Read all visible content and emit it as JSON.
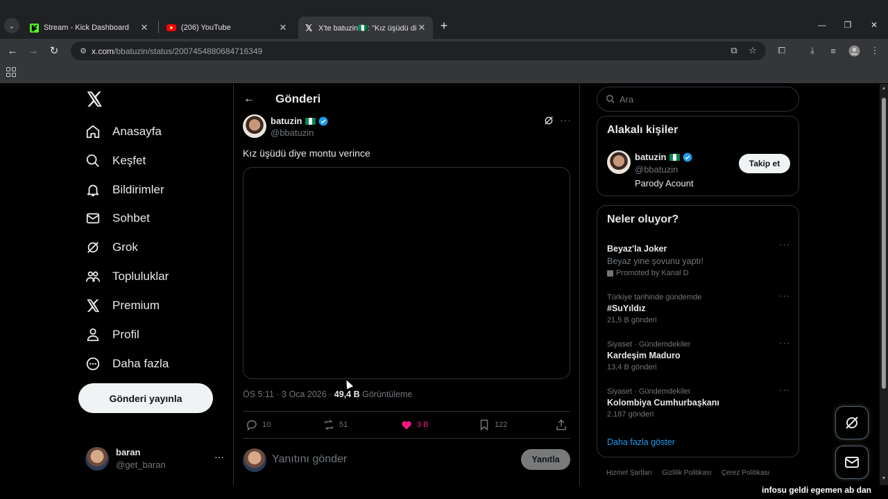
{
  "browser": {
    "tabs": [
      {
        "title": "Stream - Kick Dashboard",
        "close": "✕"
      },
      {
        "title": "(206) YouTube",
        "close": "✕"
      },
      {
        "title": "X'te batuzin🇳🇬: \"Kız üşüdü diye",
        "close": "✕"
      }
    ],
    "new_tab": "+",
    "url_host": "x.com",
    "url_path": "/bbatuzin/status/2007454880684716349",
    "window": {
      "minimize": "—",
      "restore": "❐",
      "close": "✕"
    }
  },
  "nav": {
    "items": [
      {
        "label": "Anasayfa",
        "icon": "home-icon"
      },
      {
        "label": "Keşfet",
        "icon": "search-icon"
      },
      {
        "label": "Bildirimler",
        "icon": "bell-icon"
      },
      {
        "label": "Sohbet",
        "icon": "mail-icon"
      },
      {
        "label": "Grok",
        "icon": "grok-icon"
      },
      {
        "label": "Topluluklar",
        "icon": "communities-icon"
      },
      {
        "label": "Premium",
        "icon": "x-icon"
      },
      {
        "label": "Profil",
        "icon": "person-icon"
      },
      {
        "label": "Daha fazla",
        "icon": "more-circle-icon"
      }
    ],
    "post_button": "Gönderi yayınla",
    "account": {
      "name": "baran",
      "handle": "@get_baran",
      "more": "···"
    }
  },
  "post": {
    "header_title": "Gönderi",
    "author_name": "batuzin",
    "author_handle": "@bbatuzin",
    "text": "Kız üşüdü diye montu verince",
    "time": "ÖS 5:11",
    "date": "3 Oca 2026",
    "views": "49,4 B",
    "views_label": "Görüntüleme",
    "replies": "10",
    "reposts": "51",
    "likes": "3 B",
    "bookmarks": "122",
    "reply_placeholder": "Yanıtını gönder",
    "reply_button": "Yanıtla"
  },
  "sidebar": {
    "search_placeholder": "Ara",
    "related_title": "Alakalı kişiler",
    "related": {
      "name": "batuzin",
      "handle": "@bbatuzin",
      "bio": "Parody Acount",
      "follow": "Takip et"
    },
    "trending_title": "Neler oluyor?",
    "trends": [
      {
        "name": "Beyaz'la Joker",
        "sub": "Beyaz yine şovunu yaptı!",
        "promo": "Promoted by Kanal D"
      },
      {
        "context": "Türkiye tarihinde gündemde",
        "name": "#SuYıldız",
        "count": "21,5 B gönderi"
      },
      {
        "context": "Siyaset · Gündemdekiler",
        "name": "Kardeşim Maduro",
        "count": "13,4 B gönderi"
      },
      {
        "context": "Siyaset · Gündemdekiler",
        "name": "Kolombiya Cumhurbaşkanı",
        "count": "2.187 gönderi"
      }
    ],
    "show_more": "Daha fazla göster",
    "footer": [
      "Hizmet Şartları",
      "Gizlilik Politikası",
      "Çerez Politikası"
    ]
  },
  "overlay_text": "infosu geldi egemen ab dan",
  "colors": {
    "accent": "#1d9bf0",
    "like": "#f91880",
    "background": "#000000",
    "border": "#2f3336"
  }
}
